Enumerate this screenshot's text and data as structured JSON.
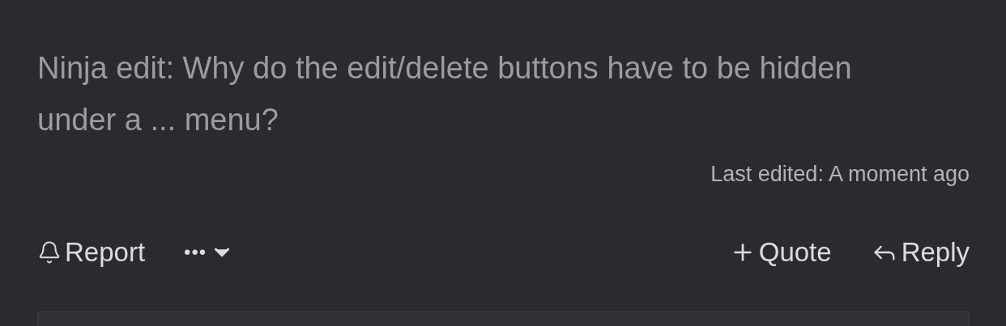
{
  "post": {
    "body": "Ninja edit: Why do the edit/delete buttons have to be hidden under a ... menu?",
    "last_edited": "Last edited: A moment ago"
  },
  "actions_left": [
    {
      "kind": "report",
      "label": "Report"
    },
    {
      "kind": "more",
      "label": "•••"
    }
  ],
  "actions_right": [
    {
      "kind": "quote",
      "label": "Quote"
    },
    {
      "kind": "reply",
      "label": "Reply"
    }
  ],
  "reply_box": {
    "kind": "empty"
  }
}
